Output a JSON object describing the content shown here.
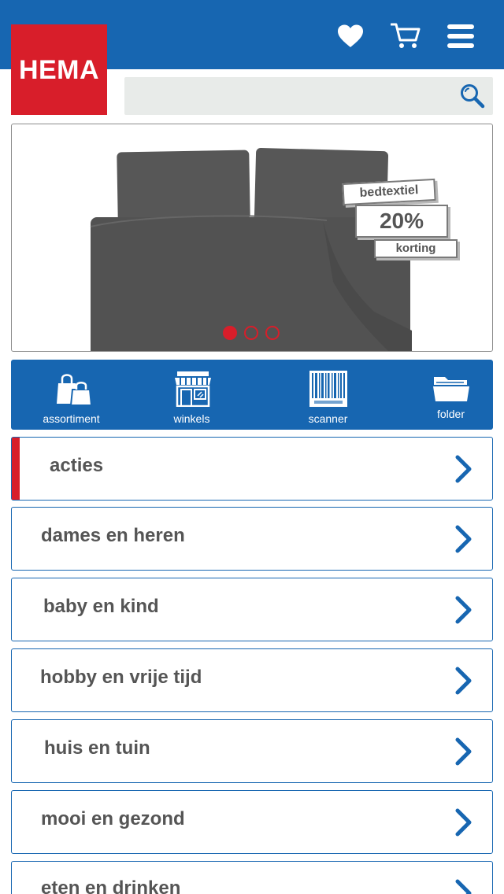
{
  "brand": {
    "logo_text": "HEMA",
    "logo_color": "#d81e2a",
    "primary_color": "#1766b1"
  },
  "header": {
    "icons": [
      "heart-icon",
      "cart-icon",
      "menu-icon"
    ]
  },
  "search": {
    "placeholder": "",
    "value": ""
  },
  "banner": {
    "tag_top": "bedtextiel",
    "tag_percent": "20%",
    "tag_bottom": "korting",
    "slides": 3,
    "active_slide": 1
  },
  "quicknav": {
    "items": [
      {
        "label": "assortiment",
        "icon": "shopping-bags-icon"
      },
      {
        "label": "winkels",
        "icon": "storefront-icon"
      },
      {
        "label": "scanner",
        "icon": "barcode-icon"
      },
      {
        "label": "folder",
        "icon": "folder-icon"
      }
    ]
  },
  "categories": [
    {
      "label": "acties",
      "highlighted": true
    },
    {
      "label": "dames en heren"
    },
    {
      "label": "baby en kind"
    },
    {
      "label": "hobby en vrije tijd"
    },
    {
      "label": "huis en tuin"
    },
    {
      "label": "mooi en gezond"
    },
    {
      "label": "eten en drinken"
    }
  ]
}
